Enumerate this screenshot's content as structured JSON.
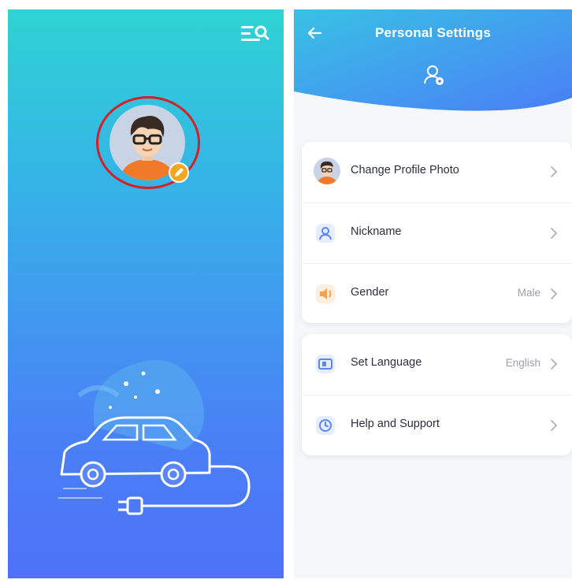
{
  "left_screen": {
    "icons": {
      "menu_search": "menu-search-icon",
      "avatar": "avatar",
      "edit": "pencil-icon",
      "illustration": "electric-car-charging-illustration"
    },
    "highlight_color": "#d61f26"
  },
  "right_screen": {
    "title": "Personal Settings",
    "icons": {
      "back": "back-arrow-icon",
      "header": "user-settings-icon"
    },
    "accent_color": "#4a7ef6",
    "settings_group_1": [
      {
        "label": "Change Profile Photo",
        "value": "",
        "icon": "avatar"
      },
      {
        "label": "Nickname",
        "value": "",
        "icon": "person-icon"
      },
      {
        "label": "Gender",
        "value": "Male",
        "icon": "gender-icon"
      }
    ],
    "settings_group_2": [
      {
        "label": "Set Language",
        "value": "English",
        "icon": "language-icon"
      },
      {
        "label": "Help and Support",
        "value": "",
        "icon": "help-icon"
      }
    ]
  }
}
